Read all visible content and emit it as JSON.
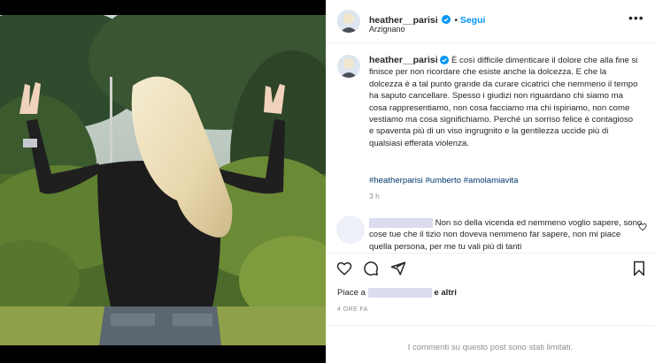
{
  "post": {
    "username": "heather__parisi",
    "follow_label": "Segui",
    "location": "Arzignano",
    "more_icon": "more-options-icon"
  },
  "caption": {
    "username": "heather__parisi",
    "text": "È così difficile dimenticare il dolore che alla fine si finisce per non ricordare che esiste anche la dolcezza. E che la dolcezza è a tal punto grande da curare cicatrici che nemmeno il tempo ha saputo cancellare. Spesso i giudizi non riguardano chi siamo ma cosa rappresentiamo, non cosa facciamo ma chi ispiriamo, non come vestiamo ma cosa significhiamo. Perché un sorriso felice è contagioso e spaventa più di un viso ingrugnito e la gentilezza uccide più di qualsiasi efferata violenza.",
    "hashtags": "#heatherparisi #umberto #amolamiavita",
    "time": "3 h"
  },
  "comment": {
    "text": "Non so della vicenda ed nemmeno voglio sapere, sono cose tue che il tizio non doveva nemmeno far sapere, non mi piace quella persona, per me tu vali più di tanti"
  },
  "likes": {
    "prefix": "Piace a",
    "suffix": "e altri"
  },
  "date": "4 ORE FA",
  "comments_limited": "I commenti su questo post sono stati limitati.",
  "colors": {
    "accent": "#0095f6",
    "text": "#262626",
    "muted": "#8e8e8e",
    "hashtag": "#00376b"
  }
}
